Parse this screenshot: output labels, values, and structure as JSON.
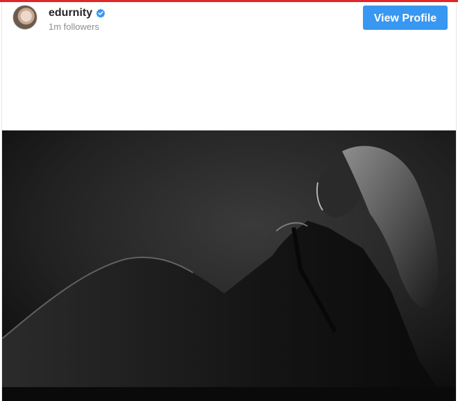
{
  "profile": {
    "username": "edurnity",
    "followers_text": "1m followers",
    "verified": true
  },
  "actions": {
    "view_profile_label": "View Profile"
  },
  "post": {
    "image_icon": "photo-image"
  },
  "colors": {
    "accent_button": "#3897f0",
    "top_strip": "#e1262a",
    "verified_badge": "#3897f0"
  }
}
